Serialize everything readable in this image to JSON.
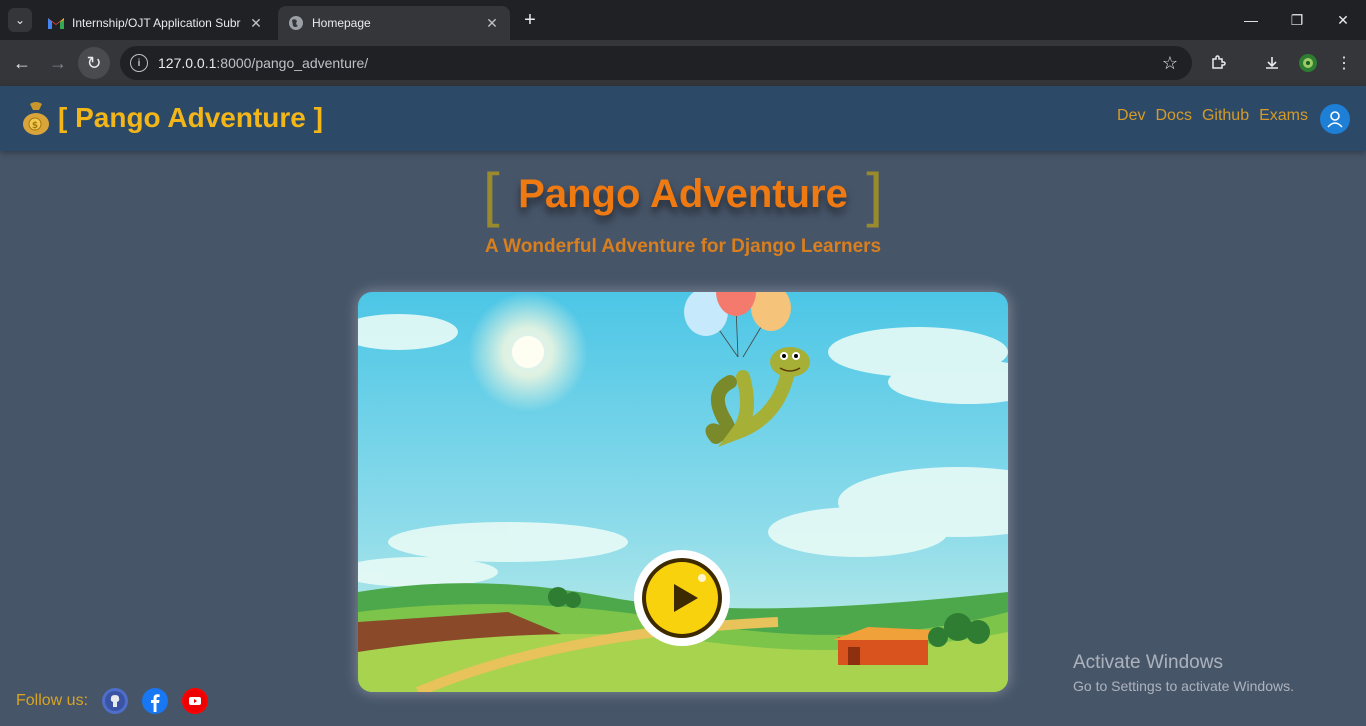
{
  "browser": {
    "tabs": [
      {
        "title": "Internship/OJT Application Subr",
        "active": false,
        "icon": "gmail-icon"
      },
      {
        "title": "Homepage",
        "active": true,
        "icon": "globe-icon"
      }
    ],
    "url_host": "127.0.0.1",
    "url_path": ":8000/pango_adventure/"
  },
  "site": {
    "brand": "[ Pango Adventure ]",
    "nav": [
      "Dev",
      "Docs",
      "Github",
      "Exams"
    ],
    "hero_left": "[",
    "hero_name": "Pango Adventure",
    "hero_right": "]",
    "subtitle": "A Wonderful Adventure for Django Learners",
    "follow_label": "Follow us:",
    "social": [
      "github-icon",
      "facebook-icon",
      "youtube-icon"
    ]
  },
  "watermark": {
    "line1": "Activate Windows",
    "line2": "Go to Settings to activate Windows."
  },
  "colors": {
    "brand": "#f2b619",
    "nav_bg": "#2c4a68",
    "page_bg": "#475569",
    "hero": "#f07a12"
  }
}
